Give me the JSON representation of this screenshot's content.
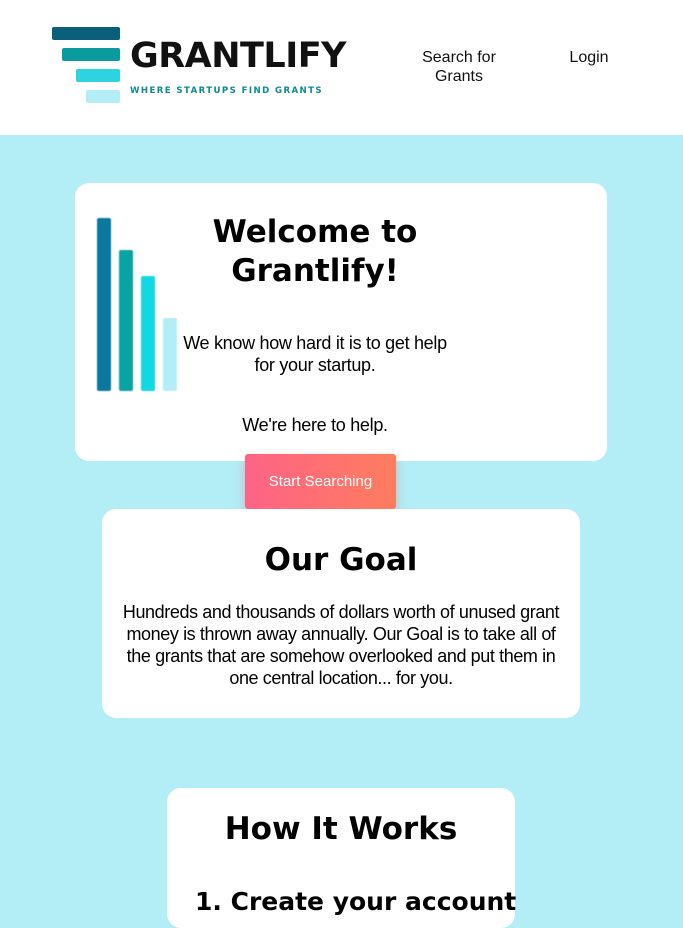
{
  "colors": {
    "background": "#b3edf5",
    "header_bg": "#ffffff",
    "card_bg": "#ffffff",
    "brand_dark": "#0a5f7a",
    "brand_teal": "#0b9a9e",
    "brand_cyan": "#2fd3e0",
    "brand_light": "#b3edf5",
    "cta_start": "#fe6386",
    "cta_end": "#fe7d5e"
  },
  "header": {
    "logo_icon": "funnel-bars-icon",
    "brand_name": "GRANTLIFY",
    "tagline": "WHERE STARTUPS FIND GRANTS",
    "nav": {
      "search_label": "Search for Grants",
      "login_label": "Login"
    }
  },
  "welcome": {
    "illustration_icon": "bar-chart-icon",
    "title": "Welcome to Grantlify!",
    "text": "We know how hard it is to get help for your startup.",
    "help_text": "We're here to help.",
    "cta_label": "Start Searching"
  },
  "goal": {
    "title": "Our Goal",
    "text": "Hundreds and thousands of dollars worth of unused grant money is thrown away annually. Our Goal is to take all of the grants that are somehow overlooked and put them in one central location... for you."
  },
  "how_it_works": {
    "title": "How It Works",
    "first_step": "1. Create your account"
  }
}
